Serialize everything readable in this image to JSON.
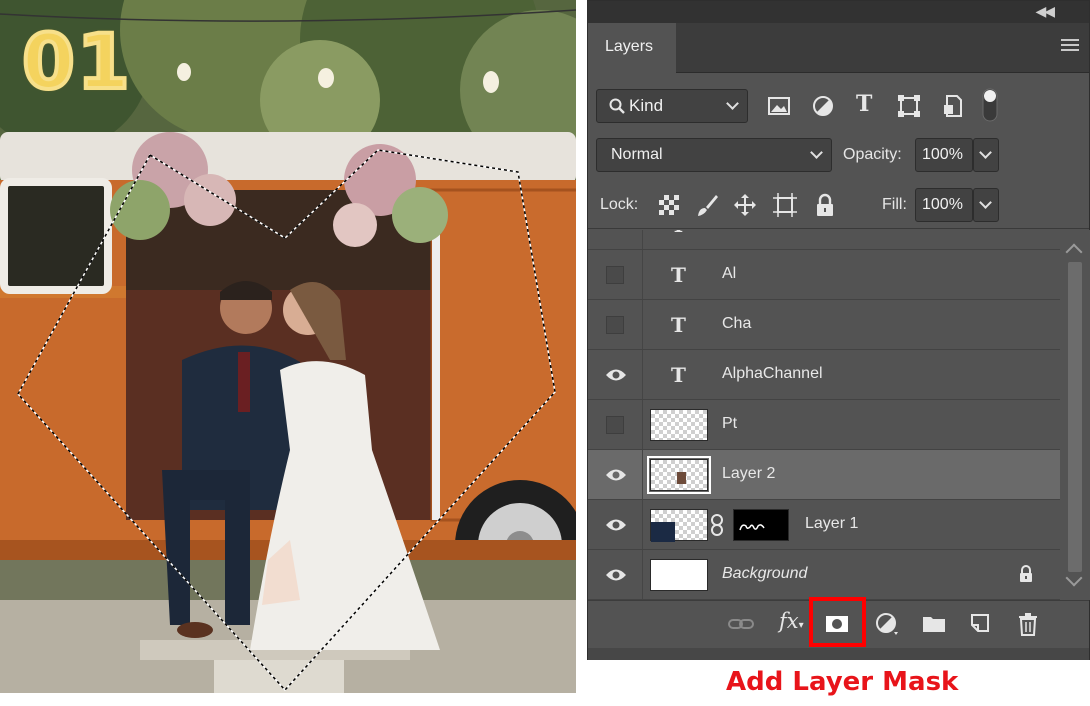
{
  "overlay": {
    "step_number": "01"
  },
  "panel": {
    "tab": "Layers",
    "filter": {
      "kind_label": "Kind",
      "icons": [
        "search-icon",
        "image-filter-icon",
        "adjustment-filter-icon",
        "type-filter-icon",
        "shape-filter-icon",
        "smart-object-filter-icon",
        "filter-toggle-icon"
      ]
    },
    "blend_mode": "Normal",
    "opacity_label": "Opacity:",
    "opacity_value": "100%",
    "lock_label": "Lock:",
    "lock_icons": [
      "lock-transparent-pixels-icon",
      "lock-image-pixels-icon",
      "lock-position-icon",
      "lock-artboard-icon",
      "lock-all-icon"
    ],
    "fill_label": "Fill:",
    "fill_value": "100%",
    "layers": [
      {
        "name": "Al",
        "kind": "text",
        "visible": false,
        "selected": false
      },
      {
        "name": "Cha",
        "kind": "text",
        "visible": false,
        "selected": false
      },
      {
        "name": "AlphaChannel",
        "kind": "text",
        "visible": true,
        "selected": false
      },
      {
        "name": "Pt",
        "kind": "pixel",
        "visible": false,
        "selected": false
      },
      {
        "name": "Layer 2",
        "kind": "pixel",
        "visible": true,
        "selected": true
      },
      {
        "name": "Layer 1",
        "kind": "pixel-with-mask",
        "visible": true,
        "selected": false
      },
      {
        "name": "Background",
        "kind": "background",
        "visible": true,
        "selected": false,
        "locked": true
      }
    ],
    "bottom_icons": [
      "link-layers-icon",
      "fx-icon",
      "add-layer-mask-icon",
      "adjustment-layer-icon",
      "group-folder-icon",
      "new-layer-icon",
      "delete-layer-icon"
    ]
  },
  "caption": "Add Layer Mask",
  "colors": {
    "highlight": "#ff0000",
    "caption": "#e8141a",
    "panel_bg": "#535353",
    "step_number": "#f4d35e"
  }
}
